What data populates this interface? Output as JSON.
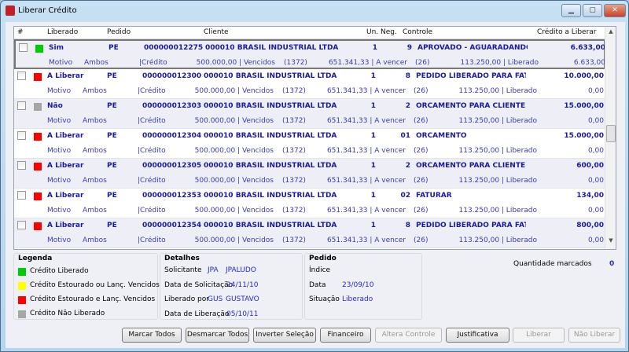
{
  "window": {
    "title": "Liberar Crédito",
    "minimize": "▁",
    "maximize": "▢",
    "close": "✕"
  },
  "columns": {
    "hash": "#",
    "liberado": "Liberado",
    "pedido": "Pedido",
    "cliente": "Cliente",
    "un_neg": "Un. Neg.",
    "controle": "Controle",
    "credito": "Crédito a Liberar"
  },
  "rows": [
    {
      "status": "Sim",
      "color": "#00cc00",
      "pedido": "PE",
      "numero": "000000012275",
      "cliente": "000010 BRASIL INDUSTRIAL  LTDA",
      "un": "1",
      "ctrl_n": "9",
      "ctrl": "APROVADO - AGUARADANDO E:",
      "credito": "6.633,00",
      "motivo": "Motivo",
      "ambos": "Ambos",
      "cred_lbl": "|Crédito",
      "venc": "500.000,00 | Vencidos",
      "venc_n": "(1372)",
      "avencer": "651.341,33 | A vencer",
      "avencer_n": "(26)",
      "lib": "113.250,00 | Liberado",
      "lib_v": "6.633,00"
    },
    {
      "status": "A Liberar",
      "color": "#ff0000",
      "pedido": "PE",
      "numero": "000000012300",
      "cliente": "000010 BRASIL INDUSTRIAL  LTDA",
      "un": "1",
      "ctrl_n": "8",
      "ctrl": "PEDIDO LIBERADO PARA FATU",
      "credito": "10.000,00",
      "motivo": "Motivo",
      "ambos": "Ambos",
      "cred_lbl": "|Crédito",
      "venc": "500.000,00 | Vencidos",
      "venc_n": "(1372)",
      "avencer": "651.341,33 | A vencer",
      "avencer_n": "(26)",
      "lib": "113.250,00 | Liberado",
      "lib_v": "0,00"
    },
    {
      "status": "Não",
      "color": "#a6a6a6",
      "pedido": "PE",
      "numero": "000000012303",
      "cliente": "000010 BRASIL INDUSTRIAL  LTDA",
      "un": "1",
      "ctrl_n": "2",
      "ctrl": "ORCAMENTO PARA CLIENTE",
      "credito": "15.000,00",
      "motivo": "Motivo",
      "ambos": "Ambos",
      "cred_lbl": "|Crédito",
      "venc": "500.000,00 | Vencidos",
      "venc_n": "(1372)",
      "avencer": "651.341,33 | A vencer",
      "avencer_n": "(26)",
      "lib": "113.250,00 | Liberado",
      "lib_v": "0,00"
    },
    {
      "status": "A Liberar",
      "color": "#ff0000",
      "pedido": "PE",
      "numero": "000000012304",
      "cliente": "000010 BRASIL INDUSTRIAL  LTDA",
      "un": "1",
      "ctrl_n": "01",
      "ctrl": "ORCAMENTO",
      "credito": "15.000,00",
      "motivo": "Motivo",
      "ambos": "Ambos",
      "cred_lbl": "|Crédito",
      "venc": "500.000,00 | Vencidos",
      "venc_n": "(1372)",
      "avencer": "651.341,33 | A vencer",
      "avencer_n": "(26)",
      "lib": "113.250,00 | Liberado",
      "lib_v": "0,00"
    },
    {
      "status": "A Liberar",
      "color": "#ff0000",
      "pedido": "PE",
      "numero": "000000012305",
      "cliente": "000010 BRASIL INDUSTRIAL  LTDA",
      "un": "1",
      "ctrl_n": "2",
      "ctrl": "ORCAMENTO PARA CLIENTE",
      "credito": "600,00",
      "motivo": "Motivo",
      "ambos": "Ambos",
      "cred_lbl": "|Crédito",
      "venc": "500.000,00 | Vencidos",
      "venc_n": "(1372)",
      "avencer": "651.341,33 | A vencer",
      "avencer_n": "(26)",
      "lib": "113.250,00 | Liberado",
      "lib_v": "0,00"
    },
    {
      "status": "A Liberar",
      "color": "#ff0000",
      "pedido": "PE",
      "numero": "000000012353",
      "cliente": "000010 BRASIL INDUSTRIAL  LTDA",
      "un": "1",
      "ctrl_n": "02",
      "ctrl": "FATURAR",
      "credito": "134,00",
      "motivo": "Motivo",
      "ambos": "Ambos",
      "cred_lbl": "|Crédito",
      "venc": "500.000,00 | Vencidos",
      "venc_n": "(1372)",
      "avencer": "651.341,33 | A vencer",
      "avencer_n": "(26)",
      "lib": "113.250,00 | Liberado",
      "lib_v": "0,00"
    },
    {
      "status": "A Liberar",
      "color": "#ff0000",
      "pedido": "PE",
      "numero": "000000012354",
      "cliente": "000010 BRASIL INDUSTRIAL  LTDA",
      "un": "1",
      "ctrl_n": "8",
      "ctrl": "PEDIDO LIBERADO PARA FATU",
      "credito": "800,00",
      "motivo": "Motivo",
      "ambos": "Ambos",
      "cred_lbl": "|Crédito",
      "venc": "500.000,00 | Vencidos",
      "venc_n": "(1372)",
      "avencer": "651.341,33 | A vencer",
      "avencer_n": "(26)",
      "lib": "113.250,00 | Liberado",
      "lib_v": "0,00"
    }
  ],
  "legend": {
    "title": "Legenda",
    "items": [
      {
        "label": "Crédito Liberado",
        "color": "#00cc00"
      },
      {
        "label": "Crédito Estourado ou Lanç. Vencidos",
        "color": "#ffff00"
      },
      {
        "label": "Crédito Estourado e Lanç. Vencidos",
        "color": "#ff0000"
      },
      {
        "label": "Crédito Não Liberado",
        "color": "#a6a6a6"
      }
    ]
  },
  "detalhes": {
    "title": "Detalhes",
    "solicitante_lbl": "Solicitante",
    "solicitante_code": "JPA",
    "solicitante": "JPALUDO",
    "data_sol_lbl": "Data de Solicitação",
    "data_sol": "24/11/10",
    "liberado_por_lbl": "Liberado por",
    "liberado_code": "GUS",
    "liberado_por": "GUSTAVO",
    "data_lib_lbl": "Data de Liberação",
    "data_lib": "05/10/11"
  },
  "pedido": {
    "title": "Pedido",
    "indice_lbl": "Índice",
    "data_lbl": "Data",
    "data": "23/09/10",
    "situacao_lbl": "Situação",
    "situacao": "Liberado"
  },
  "quantidade": {
    "label": "Quantidade marcados",
    "value": "0"
  },
  "buttons": {
    "marcar": "Marcar Todos",
    "desmarcar": "Desmarcar Todos",
    "inverter": "Inverter Seleção",
    "financeiro": "Financeiro",
    "altera": "Altera Controle",
    "justificativa": "Justificativa",
    "liberar": "Liberar",
    "nao_liberar": "Não Liberar"
  }
}
